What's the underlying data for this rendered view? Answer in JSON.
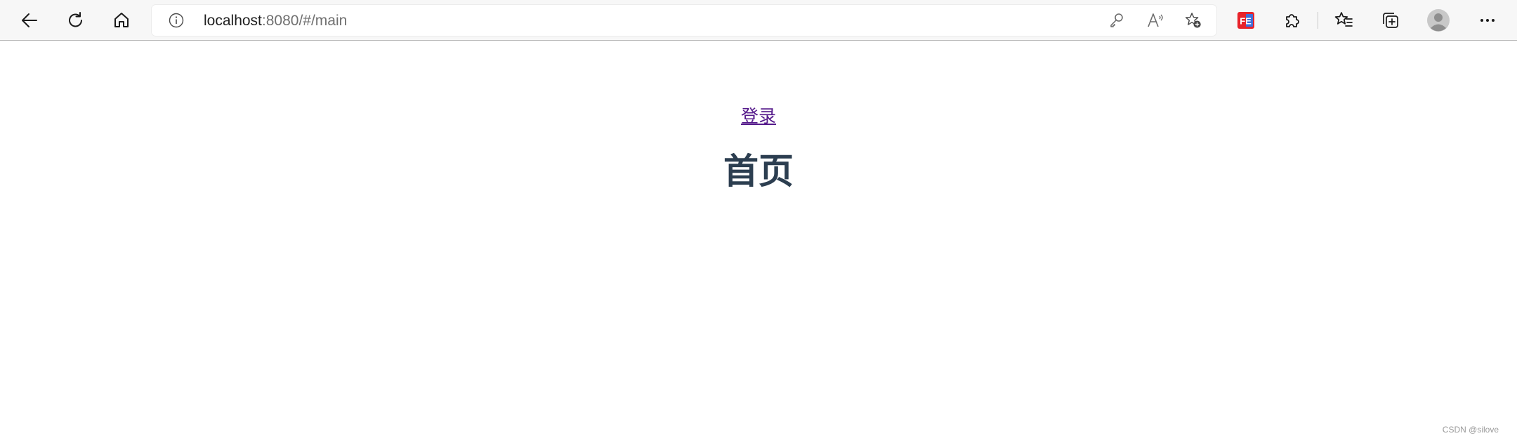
{
  "browser": {
    "address_bar": {
      "host": "localhost",
      "rest": ":8080/#/main"
    },
    "extension_badge": "FE",
    "icons": {
      "back": "back-arrow-icon",
      "refresh": "refresh-icon",
      "home": "home-icon",
      "site_info": "info-icon",
      "password": "key-icon",
      "read_aloud": "read-aloud-icon",
      "add_favorite": "star-add-icon",
      "extensions": "puzzle-icon",
      "favorites": "favorites-icon",
      "collections": "collections-icon",
      "profile": "avatar-icon",
      "more": "more-icon"
    }
  },
  "page": {
    "login_link": "登录",
    "heading": "首页",
    "link_color": "#551a8b",
    "heading_color": "#2c3e50"
  },
  "watermark": "CSDN @silove"
}
